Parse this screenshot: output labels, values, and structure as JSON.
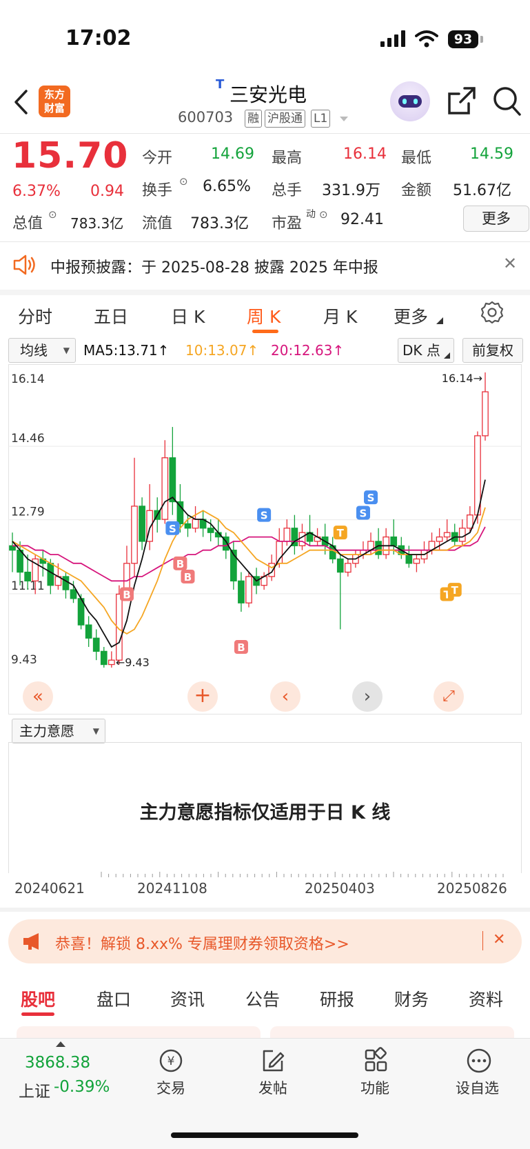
{
  "status_bar": {
    "time": "17:02",
    "battery": "93"
  },
  "header": {
    "logo_text_1": "东方",
    "logo_text_2": "财富",
    "badge": "T",
    "stock_name": "三安光电",
    "stock_code": "600703",
    "tags": [
      "融",
      "沪股通",
      "L1"
    ]
  },
  "quote": {
    "price": "15.70",
    "change_pct": "6.37%",
    "change_abs": "0.94",
    "open_label": "今开",
    "open": "14.69",
    "high_label": "最高",
    "high": "16.14",
    "low_label": "最低",
    "low": "14.59",
    "turnover_label": "换手",
    "turnover": "6.65%",
    "volume_label": "总手",
    "volume": "331.9万",
    "amount_label": "金额",
    "amount": "51.67亿",
    "mktcap_label": "总值",
    "mktcap": "783.3亿",
    "float_label": "流值",
    "float": "783.3亿",
    "pe_label": "市盈",
    "pe_sup": "动",
    "pe": "92.41",
    "more_label": "更多"
  },
  "notice": {
    "text": "中报预披露：于 2025-08-28 披露 2025 年中报"
  },
  "tabs": [
    {
      "label": "分时"
    },
    {
      "label": "五日"
    },
    {
      "label": "日 K"
    },
    {
      "label": "周 K",
      "active": true
    },
    {
      "label": "月 K"
    },
    {
      "label": "更多"
    }
  ],
  "chart_toolbar": {
    "ma_select": "均线",
    "ma5": "MA5:13.71↑",
    "ma10": "10:13.07↑",
    "ma20": "20:12.63↑",
    "dk": "DK 点",
    "adjust": "前复权"
  },
  "chart_data": {
    "type": "candlestick",
    "y_ticks": [
      "16.14",
      "14.46",
      "12.79",
      "11.11",
      "9.43"
    ],
    "ylim": [
      9.43,
      16.14
    ],
    "max_label": "16.14→",
    "min_label": "←9.43",
    "series": [
      {
        "name": "MA5",
        "color": "#111111"
      },
      {
        "name": "10",
        "color": "#f5a623"
      },
      {
        "name": "20",
        "color": "#d6157c"
      }
    ],
    "candles": [
      [
        12.2,
        12.1,
        12.5,
        11.6
      ],
      [
        12.1,
        11.6,
        12.3,
        11.3
      ],
      [
        11.6,
        11.4,
        12.0,
        11.2
      ],
      [
        11.4,
        11.9,
        12.0,
        11.1
      ],
      [
        11.9,
        11.8,
        12.1,
        11.5
      ],
      [
        11.8,
        11.3,
        11.9,
        11.1
      ],
      [
        11.3,
        11.5,
        11.8,
        11.2
      ],
      [
        11.5,
        11.2,
        11.6,
        11.0
      ],
      [
        11.2,
        11.0,
        11.4,
        10.9
      ],
      [
        11.0,
        10.4,
        11.1,
        10.3
      ],
      [
        10.4,
        10.1,
        10.6,
        9.9
      ],
      [
        10.1,
        9.8,
        10.3,
        9.6
      ],
      [
        9.8,
        9.5,
        9.9,
        9.43
      ],
      [
        9.5,
        9.6,
        9.8,
        9.43
      ],
      [
        9.6,
        11.1,
        11.3,
        9.5
      ],
      [
        11.1,
        11.8,
        12.2,
        11.0
      ],
      [
        11.8,
        13.1,
        14.2,
        11.5
      ],
      [
        13.1,
        12.3,
        13.3,
        12.1
      ],
      [
        12.3,
        13.0,
        13.6,
        12.1
      ],
      [
        13.0,
        12.8,
        13.3,
        12.5
      ],
      [
        12.8,
        14.2,
        14.6,
        12.7
      ],
      [
        14.2,
        13.2,
        14.9,
        12.9
      ],
      [
        13.2,
        12.7,
        13.6,
        12.5
      ],
      [
        12.7,
        12.6,
        12.9,
        12.4
      ],
      [
        12.6,
        12.8,
        13.1,
        12.5
      ],
      [
        12.8,
        12.6,
        13.0,
        12.4
      ],
      [
        12.6,
        12.5,
        12.8,
        12.3
      ],
      [
        12.5,
        12.4,
        12.8,
        12.2
      ],
      [
        12.4,
        12.1,
        12.5,
        11.9
      ],
      [
        12.1,
        11.4,
        12.3,
        11.2
      ],
      [
        11.4,
        10.9,
        11.6,
        10.7
      ],
      [
        10.9,
        11.5,
        11.6,
        10.8
      ],
      [
        11.5,
        11.3,
        11.7,
        11.1
      ],
      [
        11.3,
        11.5,
        11.6,
        11.2
      ],
      [
        11.5,
        11.8,
        12.0,
        11.4
      ],
      [
        11.8,
        12.3,
        12.6,
        11.7
      ],
      [
        12.3,
        12.6,
        12.8,
        12.2
      ],
      [
        12.6,
        12.2,
        12.9,
        12.0
      ],
      [
        12.2,
        12.5,
        12.7,
        12.1
      ],
      [
        12.5,
        12.3,
        12.9,
        12.2
      ],
      [
        12.3,
        12.4,
        12.6,
        12.2
      ],
      [
        12.4,
        12.2,
        12.7,
        12.0
      ],
      [
        12.2,
        11.9,
        12.4,
        11.8
      ],
      [
        11.9,
        11.6,
        12.0,
        10.3
      ],
      [
        11.6,
        11.8,
        11.9,
        11.5
      ],
      [
        11.8,
        12.0,
        12.1,
        11.7
      ],
      [
        12.0,
        12.1,
        12.3,
        11.9
      ],
      [
        12.1,
        12.3,
        12.5,
        12.0
      ],
      [
        12.3,
        12.0,
        12.6,
        11.9
      ],
      [
        12.0,
        12.4,
        12.6,
        11.9
      ],
      [
        12.4,
        12.2,
        12.8,
        12.0
      ],
      [
        12.2,
        12.0,
        12.4,
        11.9
      ],
      [
        12.0,
        11.8,
        12.2,
        11.7
      ],
      [
        11.8,
        11.9,
        12.0,
        11.6
      ],
      [
        11.9,
        12.1,
        12.3,
        11.8
      ],
      [
        12.1,
        12.3,
        12.5,
        12.0
      ],
      [
        12.3,
        12.4,
        12.6,
        12.1
      ],
      [
        12.4,
        12.5,
        12.8,
        12.3
      ],
      [
        12.5,
        12.3,
        12.7,
        12.2
      ],
      [
        12.3,
        12.6,
        12.8,
        12.2
      ],
      [
        12.6,
        12.9,
        13.1,
        12.5
      ],
      [
        12.9,
        14.7,
        14.8,
        12.7
      ],
      [
        14.7,
        15.7,
        16.14,
        14.59
      ]
    ],
    "ma5": [
      12.3,
      12.1,
      11.9,
      11.8,
      11.7,
      11.6,
      11.5,
      11.4,
      11.3,
      11.0,
      10.7,
      10.5,
      10.2,
      9.9,
      10.0,
      10.5,
      11.3,
      11.9,
      12.6,
      12.9,
      13.2,
      13.3,
      13.1,
      12.9,
      12.8,
      12.8,
      12.7,
      12.5,
      12.3,
      12.0,
      11.8,
      11.6,
      11.4,
      11.5,
      11.6,
      11.9,
      12.1,
      12.3,
      12.4,
      12.5,
      12.4,
      12.3,
      12.2,
      12.0,
      11.9,
      11.9,
      12.0,
      12.1,
      12.2,
      12.2,
      12.2,
      12.1,
      12.0,
      12.0,
      12.0,
      12.1,
      12.2,
      12.3,
      12.4,
      12.4,
      12.5,
      12.9,
      13.7
    ],
    "ma10": [
      12.3,
      12.2,
      12.1,
      12.0,
      11.9,
      11.8,
      11.7,
      11.6,
      11.5,
      11.4,
      11.2,
      11.0,
      10.8,
      10.5,
      10.3,
      10.2,
      10.3,
      10.6,
      11.0,
      11.4,
      11.9,
      12.3,
      12.6,
      12.8,
      12.9,
      13.0,
      12.9,
      12.8,
      12.6,
      12.5,
      12.3,
      12.1,
      11.9,
      11.8,
      11.7,
      11.8,
      11.8,
      11.9,
      12.0,
      12.1,
      12.1,
      12.1,
      12.1,
      12.0,
      12.0,
      12.0,
      12.0,
      12.0,
      12.1,
      12.1,
      12.1,
      12.0,
      12.0,
      12.0,
      12.0,
      12.1,
      12.1,
      12.1,
      12.2,
      12.2,
      12.3,
      12.5,
      13.07
    ],
    "ma20": [
      12.2,
      12.2,
      12.2,
      12.1,
      12.1,
      12.0,
      12.0,
      11.9,
      11.8,
      11.8,
      11.7,
      11.6,
      11.5,
      11.4,
      11.4,
      11.4,
      11.5,
      11.5,
      11.6,
      11.7,
      11.8,
      11.9,
      11.9,
      12.0,
      12.0,
      12.1,
      12.1,
      12.2,
      12.2,
      12.3,
      12.3,
      12.4,
      12.4,
      12.4,
      12.4,
      12.3,
      12.3,
      12.3,
      12.3,
      12.2,
      12.2,
      12.2,
      12.1,
      12.1,
      12.1,
      12.1,
      12.1,
      12.1,
      12.1,
      12.1,
      12.1,
      12.1,
      12.1,
      12.1,
      12.1,
      12.1,
      12.1,
      12.1,
      12.1,
      12.2,
      12.2,
      12.3,
      12.63
    ],
    "signals": [
      {
        "label": "S",
        "index": 21,
        "price": 12.6,
        "color": "#4a8ff0"
      },
      {
        "label": "B",
        "index": 22,
        "price": 11.8,
        "color": "#f07a7a"
      },
      {
        "label": "B",
        "index": 23,
        "price": 11.5,
        "color": "#f07a7a"
      },
      {
        "label": "B",
        "index": 15,
        "price": 11.1,
        "color": "#f07a7a"
      },
      {
        "label": "B",
        "index": 30,
        "price": 9.9,
        "color": "#f07a7a"
      },
      {
        "label": "S",
        "index": 33,
        "price": 12.9,
        "color": "#4a8ff0"
      },
      {
        "label": "T",
        "index": 43,
        "price": 12.5,
        "color": "#f5a623"
      },
      {
        "label": "S",
        "index": 46,
        "price": 12.95,
        "color": "#4a8ff0"
      },
      {
        "label": "S",
        "index": 47,
        "price": 13.3,
        "color": "#4a8ff0"
      },
      {
        "label": "T",
        "index": 57,
        "price": 11.1,
        "color": "#f5a623"
      },
      {
        "label": "T",
        "index": 58,
        "price": 11.2,
        "color": "#f5a623"
      }
    ]
  },
  "indicator": {
    "select": "主力意愿",
    "message": "主力意愿指标仅适用于日 K 线"
  },
  "dates": [
    "20240621",
    "20241108",
    "20250403",
    "20250826"
  ],
  "promo": {
    "text": "恭喜！解锁 8.xx% 专属理财券领取资格>>"
  },
  "bottom_tabs": [
    {
      "label": "股吧",
      "active": true
    },
    {
      "label": "盘口"
    },
    {
      "label": "资讯"
    },
    {
      "label": "公告"
    },
    {
      "label": "研报"
    },
    {
      "label": "财务"
    },
    {
      "label": "资料"
    }
  ],
  "bottom_bar": {
    "index_value": "3868.38",
    "index_name": "上证",
    "index_change": "-0.39%",
    "items": [
      {
        "label": "交易"
      },
      {
        "label": "发帖"
      },
      {
        "label": "功能"
      },
      {
        "label": "设自选"
      }
    ]
  }
}
